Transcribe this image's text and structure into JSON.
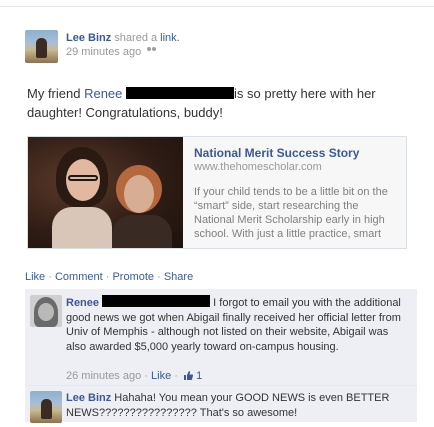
{
  "post": {
    "author": "Lee Binz",
    "shared_text": "shared a",
    "shared_link": "link.",
    "timestamp": "29 minutes ago",
    "audience_icon": "friends-icon",
    "status_prefix": "My friend ",
    "status_tag": "Renee",
    "status_suffix": "is so pretty here with her daughter! Congratulations, buddy!"
  },
  "link_preview": {
    "title": "National Merit Success Story",
    "url": "www.thehomescholar.com",
    "description": "If your child tends to be a little bit on the “smart” side, start researching the National Merit Scholarship early in high school. With just a little practice, smart"
  },
  "actions": {
    "like": "Like",
    "comment": "Comment",
    "promote": "Promote",
    "share": "Share",
    "separator": "·"
  },
  "comments": [
    {
      "author": "Renee",
      "text": "I forgot to email you with the additional good news we got when Abigail finally received her official letter from Univ of Memphis - although not listed on their website, Abigail was also awarded $5,000 yearly toward on-campus housing.",
      "timestamp": "26 minutes ago",
      "like_label": "Like",
      "like_count": "1"
    },
    {
      "author": "Lee Binz",
      "text": "Hahaha! You mean your GOOD NEWS is even BETTER NEWS???????????????? That's so awesome!"
    }
  ],
  "colors": {
    "link_blue": "#3b5998",
    "meta_gray": "#999999",
    "comment_bg": "#edeff4"
  }
}
